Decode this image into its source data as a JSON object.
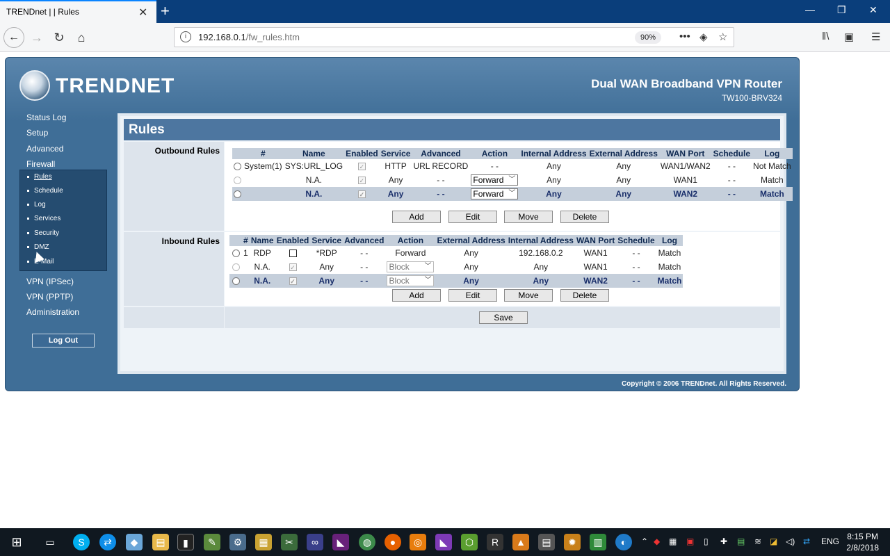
{
  "browser": {
    "tab_title": "TRENDnet | | Rules",
    "url_host": "192.168.0.1",
    "url_path": "/fw_rules.htm",
    "zoom": "90%"
  },
  "router": {
    "logo": "TRENDNET",
    "product": "Dual WAN Broadband VPN Router",
    "model": "TW100-BRV324",
    "nav": {
      "status_log": "Status Log",
      "setup": "Setup",
      "advanced": "Advanced",
      "firewall": "Firewall",
      "vpn_ipsec": "VPN (IPSec)",
      "vpn_pptp": "VPN (PPTP)",
      "administration": "Administration"
    },
    "subnav": [
      "Rules",
      "Schedule",
      "Log",
      "Services",
      "Security",
      "DMZ",
      "E-Mail"
    ],
    "logout": "Log Out",
    "page_title": "Rules",
    "copyright": "Copyright © 2006 TRENDnet. All Rights Reserved."
  },
  "outbound": {
    "label": "Outbound Rules",
    "headers": [
      "#",
      "Name",
      "Enabled",
      "Service",
      "Advanced",
      "Action",
      "Internal Address",
      "External Address",
      "WAN Port",
      "Schedule",
      "Log"
    ],
    "rows": [
      {
        "num": "System(1)",
        "name": "SYS:URL_LOG",
        "service": "HTTP",
        "advanced": "URL RECORD",
        "action": "- -",
        "internal": "Any",
        "external": "Any",
        "wan": "WAN1/WAN2",
        "schedule": "- -",
        "log": "Not Match"
      },
      {
        "num": "",
        "name": "N.A.",
        "service": "Any",
        "advanced": "- -",
        "action": "Forward",
        "internal": "Any",
        "external": "Any",
        "wan": "WAN1",
        "schedule": "- -",
        "log": "Match"
      },
      {
        "num": "",
        "name": "N.A.",
        "service": "Any",
        "advanced": "- -",
        "action": "Forward",
        "internal": "Any",
        "external": "Any",
        "wan": "WAN2",
        "schedule": "- -",
        "log": "Match"
      }
    ]
  },
  "inbound": {
    "label": "Inbound Rules",
    "headers": [
      "#",
      "Name",
      "Enabled",
      "Service",
      "Advanced",
      "Action",
      "External Address",
      "Internal Address",
      "WAN Port",
      "Schedule",
      "Log"
    ],
    "rows": [
      {
        "num": "1",
        "name": "RDP",
        "service": "*RDP",
        "advanced": "- -",
        "action": "Forward",
        "external": "Any",
        "internal": "192.168.0.2",
        "wan": "WAN1",
        "schedule": "- -",
        "log": "Match"
      },
      {
        "num": "",
        "name": "N.A.",
        "service": "Any",
        "advanced": "- -",
        "action": "Block",
        "external": "Any",
        "internal": "Any",
        "wan": "WAN1",
        "schedule": "- -",
        "log": "Match"
      },
      {
        "num": "",
        "name": "N.A.",
        "service": "Any",
        "advanced": "- -",
        "action": "Block",
        "external": "Any",
        "internal": "Any",
        "wan": "WAN2",
        "schedule": "- -",
        "log": "Match"
      }
    ]
  },
  "buttons": {
    "add": "Add",
    "edit": "Edit",
    "move": "Move",
    "delete": "Delete",
    "save": "Save"
  },
  "taskbar": {
    "lang": "ENG",
    "time": "8:15 PM",
    "date": "2/8/2018"
  }
}
